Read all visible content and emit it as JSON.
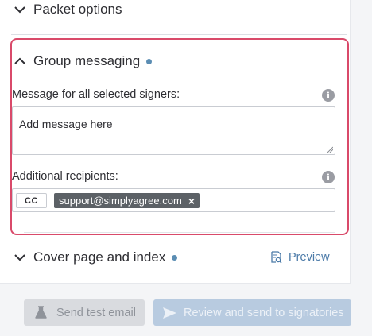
{
  "sections": {
    "packet_options": {
      "label": "Packet options"
    },
    "group_messaging": {
      "label": "Group messaging",
      "message_label": "Message for all selected signers:",
      "message_placeholder": "Add message here",
      "recipients_label": "Additional recipients:",
      "cc_label": "CC",
      "recipient_chip": "support@simplyagree.com"
    },
    "cover_page": {
      "label": "Cover page and index",
      "preview_label": "Preview"
    }
  },
  "footer": {
    "send_test_label": "Send test email",
    "review_label": "Review and send to signatories"
  },
  "colors": {
    "highlight_border": "#d94a6a",
    "status_dot": "#5b8db3",
    "link": "#4b7aa8",
    "chip_bg": "#5c6166"
  },
  "icons": {
    "packet_chevron": "chevron-down-icon",
    "group_chevron": "chevron-up-icon",
    "cover_chevron": "chevron-down-icon",
    "info": "info-icon",
    "remove": "close-icon",
    "preview": "document-search-icon",
    "test": "flask-icon",
    "send": "paper-plane-icon"
  }
}
